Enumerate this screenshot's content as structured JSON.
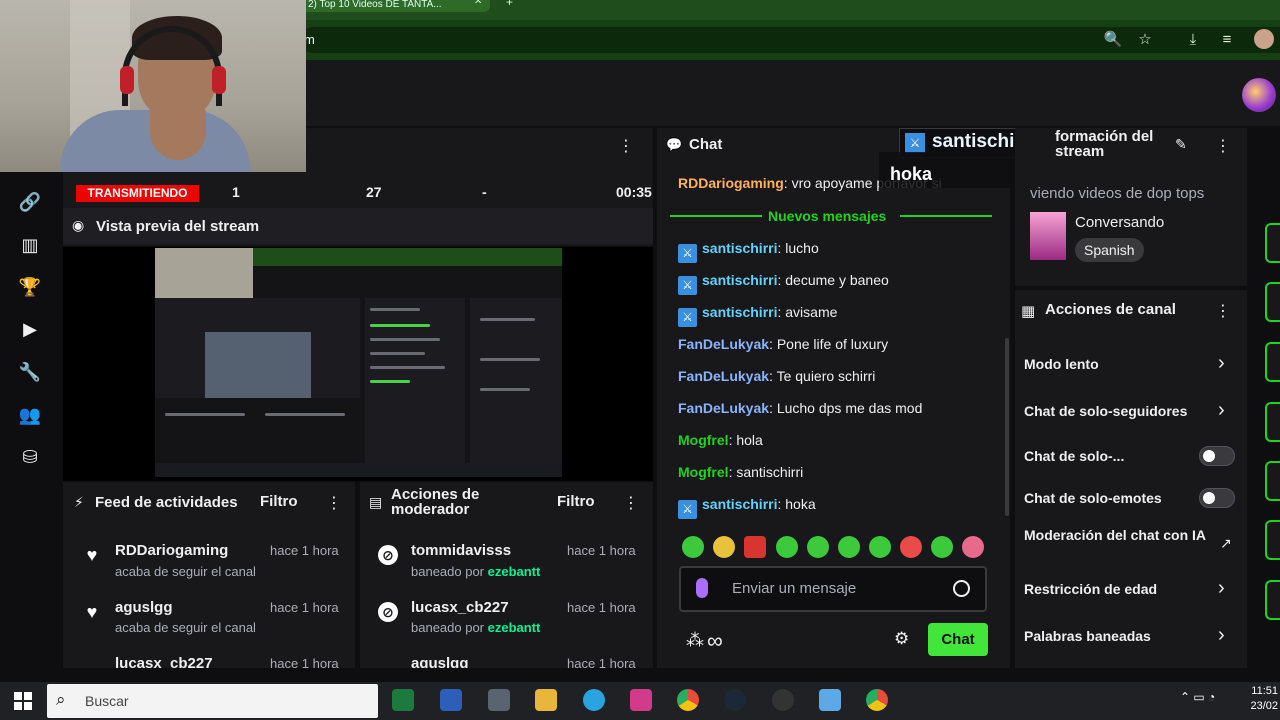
{
  "browser": {
    "tab_title": "2) Top 10 Videos DE TANTA...",
    "url": "m",
    "icons": [
      "zoom-icon",
      "star-icon",
      "download-icon",
      "playlist-icon",
      "profile-icon"
    ]
  },
  "stats": {
    "live_label": "TRANSMITIENDO",
    "viewers": "1",
    "followers": "27",
    "subs": "-",
    "time": "00:35"
  },
  "preview": {
    "title": "Vista previa del stream"
  },
  "feed": {
    "title": "Feed de actividades",
    "filter": "Filtro",
    "items": [
      {
        "name": "RDDariogaming",
        "sub": "acaba de seguir el canal",
        "time": "hace 1 hora"
      },
      {
        "name": "aguslgg",
        "sub": "acaba de seguir el canal",
        "time": "hace 1 hora"
      },
      {
        "name": "lucasx_cb227",
        "sub": "",
        "time": "hace 1 hora"
      }
    ]
  },
  "mod_actions": {
    "title_line1": "Acciones de",
    "title_line2": "moderador",
    "filter": "Filtro",
    "items": [
      {
        "name": "tommidavisss",
        "prefix": "baneado por",
        "by": "ezebantt",
        "time": "hace 1 hora"
      },
      {
        "name": "lucasx_cb227",
        "prefix": "baneado por",
        "by": "ezebantt",
        "time": "hace 1 hora"
      },
      {
        "name": "aguslgg",
        "prefix": "",
        "by": "",
        "time": "hace 1 hora"
      }
    ]
  },
  "chat": {
    "title": "Chat",
    "new_messages": "Nuevos mensajes",
    "pinned": {
      "user": "RDDariogaming",
      "text": ": vro apoyame porfavor si"
    },
    "messages": [
      {
        "user": "santischirri",
        "text": ": lucho"
      },
      {
        "user": "santischirri",
        "text": ": decume y baneo"
      },
      {
        "user": "santischirri",
        "text": ": avisame"
      },
      {
        "user": "FanDeLukyak",
        "text": ": Pone life of luxury"
      },
      {
        "user": "FanDeLukyak",
        "text": ": Te quiero schirri"
      },
      {
        "user": "FanDeLukyak",
        "text": ": Lucho dps me das mod"
      },
      {
        "user": "Mogfrel",
        "text": ": hola"
      },
      {
        "user": "Mogfrel",
        "text": ": santischirri"
      },
      {
        "user": "santischirri",
        "text": ": hoka"
      }
    ],
    "input_placeholder": "Enviar un mensaje",
    "send_label": "Chat",
    "points": "∞"
  },
  "alert": {
    "name": "santischirri",
    "message": "hoka"
  },
  "stream_info": {
    "title_line1": "formación del",
    "title_line2": "stream",
    "stream_title": "viendo videos de dop tops",
    "category": "Conversando",
    "language": "Spanish"
  },
  "channel_actions": {
    "title": "Acciones de canal",
    "items": [
      {
        "label": "Modo lento",
        "kind": "chevron"
      },
      {
        "label": "Chat de solo-seguidores",
        "kind": "chevron"
      },
      {
        "label": "Chat de solo-...",
        "kind": "toggle"
      },
      {
        "label": "Chat de solo-emotes",
        "kind": "toggle"
      },
      {
        "label": "Moderación del chat con IA",
        "kind": "external"
      },
      {
        "label": "Restricción de edad",
        "kind": "chevron"
      },
      {
        "label": "Palabras baneadas",
        "kind": "chevron"
      }
    ]
  },
  "taskbar": {
    "search_placeholder": "Buscar",
    "time": "11:51",
    "date": "23/02"
  },
  "colors": {
    "accent": "#42e53a",
    "live": "#eb0400",
    "panel": "#18181b",
    "background": "#0e0e10"
  }
}
